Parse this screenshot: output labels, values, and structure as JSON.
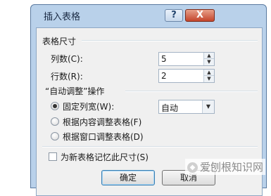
{
  "window": {
    "title": "插入表格",
    "help_label": "?",
    "close_label": "X"
  },
  "table_size": {
    "heading": "表格尺寸",
    "columns_label": "列数(C):",
    "columns_value": "5",
    "rows_label": "行数(R):",
    "rows_value": "2"
  },
  "autofit": {
    "heading": "“自动调整”操作",
    "fixed_label": "固定列宽(W):",
    "fixed_value": "自动",
    "fixed_checked": true,
    "content_label": "根据内容调整表格(F)",
    "window_label": "根据窗口调整表格(D)"
  },
  "remember": {
    "label": "为新表格记忆此尺寸(S)",
    "checked": false
  },
  "buttons": {
    "ok": "确定",
    "cancel": "取消"
  },
  "watermark": {
    "text": "爱刨根知识网"
  }
}
